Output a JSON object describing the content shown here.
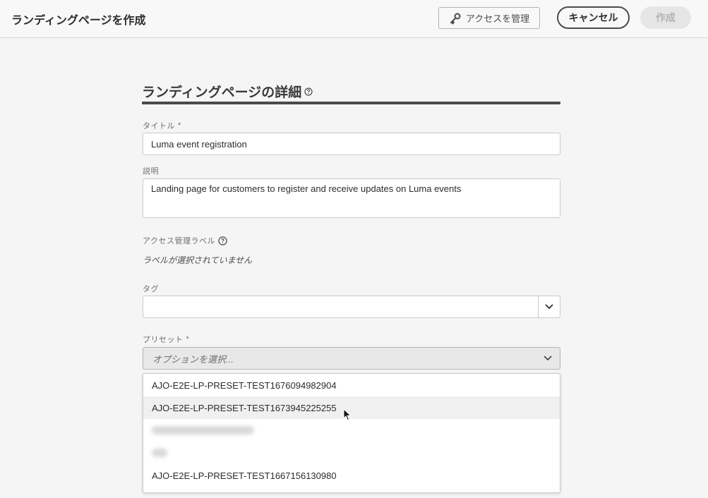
{
  "header": {
    "title": "ランディングページを作成",
    "access_button": "アクセスを管理",
    "cancel_button": "キャンセル",
    "create_button": "作成"
  },
  "section": {
    "title": "ランディングページの詳細"
  },
  "form": {
    "title_label": "タイトル",
    "title_value": "Luma event registration",
    "desc_label": "説明",
    "desc_value": "Landing page for customers to register and receive updates on Luma events",
    "access_label": "アクセス管理ラベル",
    "access_empty": "ラベルが選択されていません",
    "tag_label": "タグ",
    "preset_label": "プリセット",
    "preset_placeholder": "オプションを選択...",
    "required_mark": "*"
  },
  "dropdown": {
    "options": [
      "AJO-E2E-LP-PRESET-TEST1676094982904",
      "AJO-E2E-LP-PRESET-TEST1673945225255",
      "",
      "",
      "AJO-E2E-LP-PRESET-TEST1667156130980"
    ],
    "hovered_index": 1
  },
  "icons": {
    "key": "key-icon",
    "help": "help-circle-icon",
    "chevron": "chevron-down-icon",
    "cursor": "mouse-pointer-icon"
  }
}
